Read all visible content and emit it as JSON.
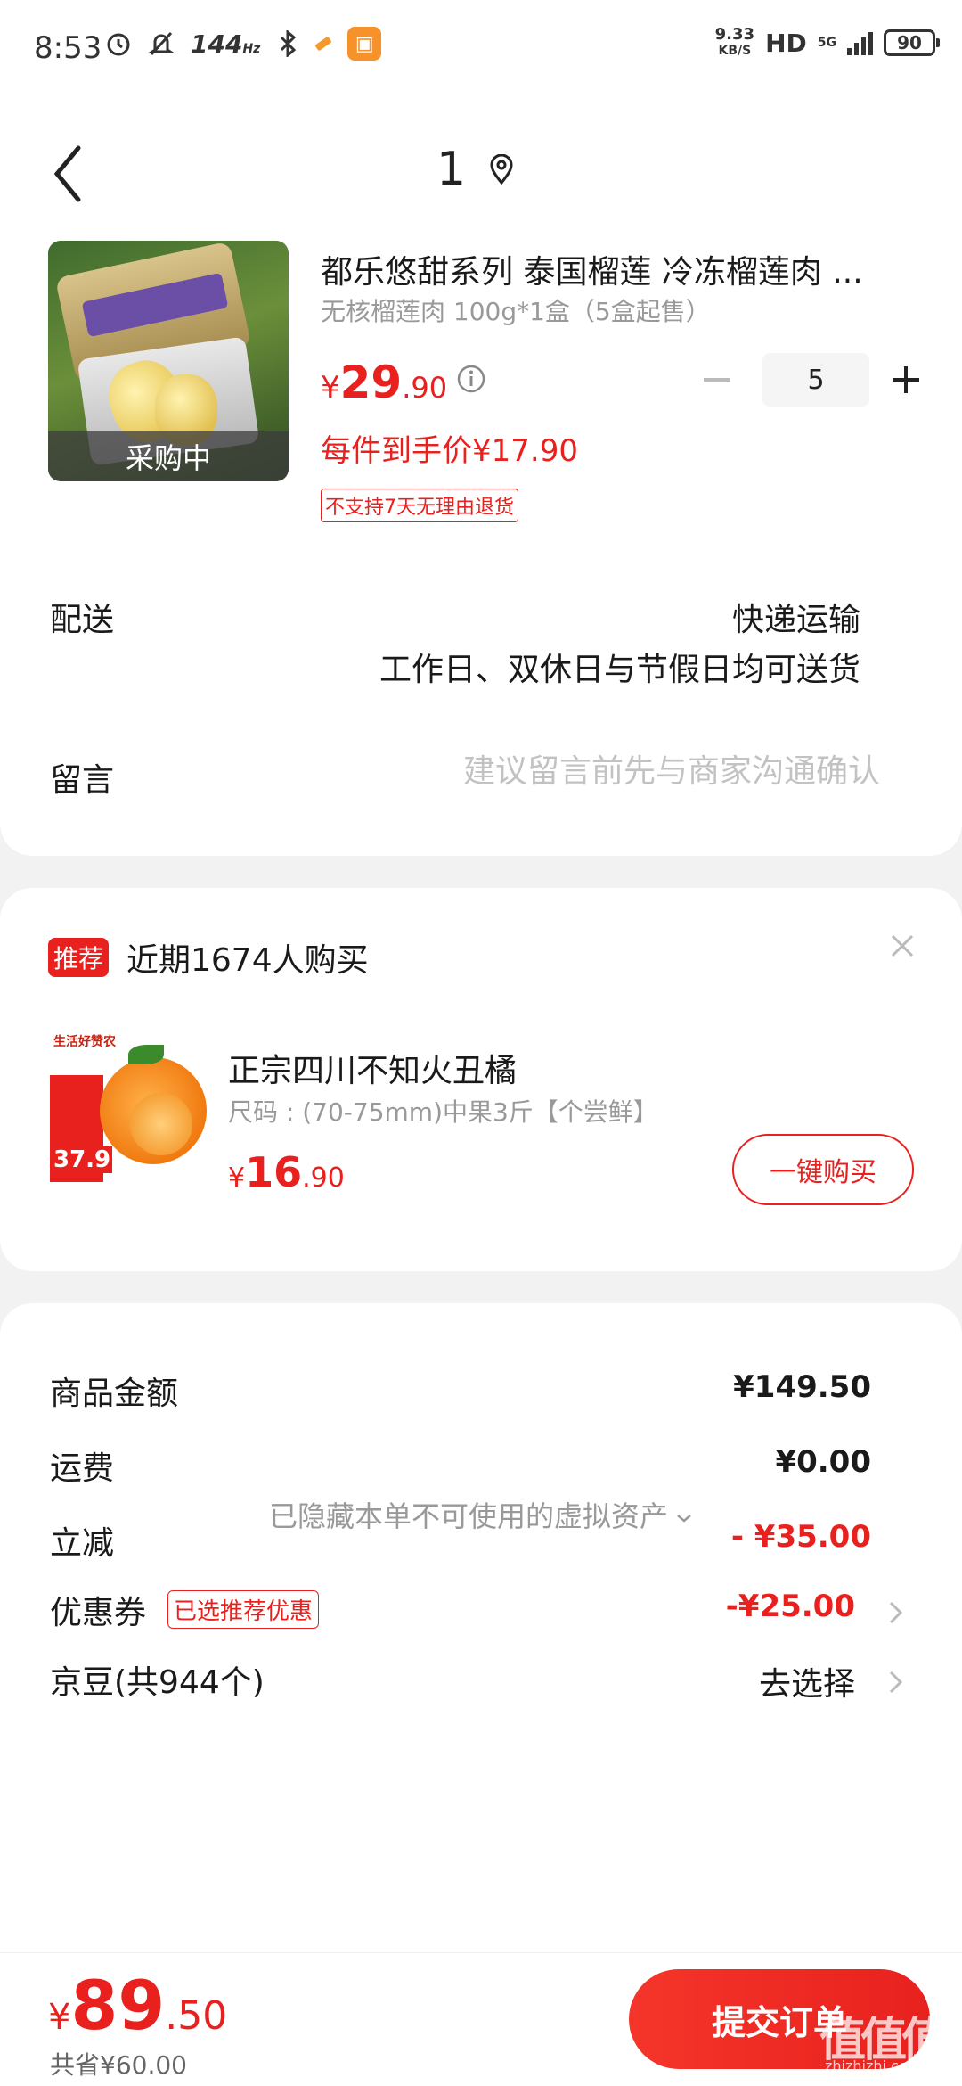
{
  "status_bar": {
    "time": "8:53",
    "refresh_rate": "144",
    "refresh_unit": "Hz",
    "speed_value": "9.33",
    "speed_unit": "KB/S",
    "hd": "HD",
    "network": "5G",
    "battery": "90",
    "icons": [
      "alarm-icon",
      "mute-icon",
      "bluetooth-icon",
      "shopping-app-icon"
    ]
  },
  "header": {
    "title": "1",
    "icons": [
      "back-arrow-icon",
      "location-pin-icon"
    ]
  },
  "product": {
    "name": "都乐悠甜系列 泰国榴莲 冷冻榴莲肉 ...",
    "spec": "无核榴莲肉 100g*1盒（5盒起售）",
    "badge": "采购中",
    "price_symbol": "¥",
    "price_int": "29",
    "price_dec": ".90",
    "quantity": "5",
    "unit_price_text": "每件到手价¥17.90",
    "return_tag": "不支持7天无理由退货"
  },
  "delivery": {
    "label": "配送",
    "method": "快递运输",
    "note": "工作日、双休日与节假日均可送货"
  },
  "message": {
    "label": "留言",
    "placeholder": "建议留言前先与商家沟通确认"
  },
  "recommend": {
    "tag": "推荐",
    "title": "近期1674人购买",
    "image_brand": "生活好赞农",
    "image_price": "37.9",
    "name": "正宗四川不知火丑橘",
    "spec": "尺码 : (70-75mm)中果3斤【个尝鲜】",
    "price_symbol": "¥",
    "price_int": "16",
    "price_dec": ".90",
    "buy_label": "一键购买"
  },
  "summary": {
    "goods_label": "商品金额",
    "goods_value": "¥149.50",
    "shipping_label": "运费",
    "shipping_value": "¥0.00",
    "discount_label": "立减",
    "discount_value": "- ¥35.00",
    "coupon_label": "优惠券",
    "coupon_tag": "已选推荐优惠",
    "coupon_value": "-¥25.00",
    "beans_label": "京豆(共944个)",
    "beans_value": "去选择",
    "hidden_assets": "已隐藏本单不可使用的虚拟资产"
  },
  "bottom": {
    "total_symbol": "¥",
    "total_int": "89",
    "total_dec": ".50",
    "saved": "共省¥60.00",
    "submit_label": "提交订单",
    "watermark": "值值值",
    "watermark_sub": "zhizhizhi.com"
  },
  "colors": {
    "accent": "#e8211e",
    "muted_text": "#999999",
    "background": "#f2f2f2"
  }
}
